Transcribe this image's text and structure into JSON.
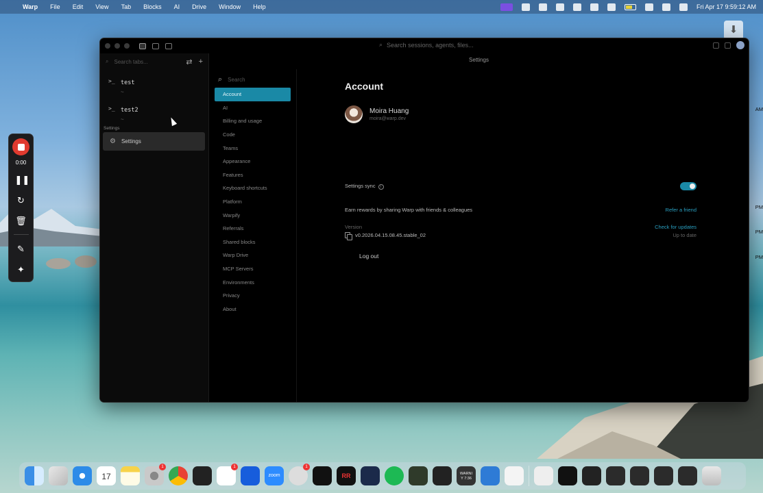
{
  "menubar": {
    "app_name": "Warp",
    "menus": [
      "File",
      "Edit",
      "View",
      "Tab",
      "Blocks",
      "AI",
      "Drive",
      "Window",
      "Help"
    ],
    "clock": "Fri Apr 17  9:59:12 AM",
    "battery": "62"
  },
  "recorder": {
    "timer": "0:00"
  },
  "window": {
    "global_search_placeholder": "Search sessions, agents, files...",
    "header_title": "Settings"
  },
  "tabs_panel": {
    "search_placeholder": "Search tabs...",
    "sessions": [
      {
        "title": "test",
        "subtitle": "~"
      },
      {
        "title": "test2",
        "subtitle": "~"
      }
    ],
    "section_label": "Settings",
    "settings_tab_label": "Settings"
  },
  "settings_nav": {
    "search_placeholder": "Search",
    "items": [
      "Account",
      "AI",
      "Billing and usage",
      "Code",
      "Teams",
      "Appearance",
      "Features",
      "Keyboard shortcuts",
      "Platform",
      "Warpify",
      "Referrals",
      "Shared blocks",
      "Warp Drive",
      "MCP Servers",
      "Environments",
      "Privacy",
      "About"
    ],
    "active": "Account"
  },
  "account": {
    "heading": "Account",
    "user_name": "Moira Huang",
    "user_email": "moira@warp.dev",
    "settings_sync_label": "Settings sync",
    "settings_sync_on": true,
    "referral_text": "Earn rewards by sharing Warp with friends & colleagues",
    "referral_link": "Refer a friend",
    "version_label": "Version",
    "version_value": "v0.2026.04.15.08.45.stable_02",
    "check_updates_label": "Check for updates",
    "update_status": "Up to date",
    "logout_label": "Log out"
  },
  "desktop_peek": [
    "AM",
    "PM",
    "PM",
    "PM"
  ],
  "colors": {
    "accent": "#1a89a6",
    "link": "#2a9fc0",
    "record": "#e03a2f"
  },
  "dock": {
    "icons": [
      "finder-icon",
      "launchpad-icon",
      "safari-icon",
      "calendar-icon",
      "notes-icon",
      "system-settings-icon",
      "chrome-icon",
      "warp-icon",
      "slack-icon",
      "bitwarden-icon",
      "zoom-icon",
      "linear-icon",
      "warp-preview-icon",
      "rr-icon",
      "terminal-icon",
      "spotify-icon",
      "spiral-icon",
      "warp-dev-icon",
      "console-icon",
      "sparkle-icon",
      "warp-alt-icon"
    ],
    "calendar_date": "17",
    "zoom_label": "zoom",
    "rr_label": "RR",
    "console_label_1": "WARNI",
    "console_label_2": "Y 7:36",
    "badges": {
      "system_settings": "1",
      "slack": "1",
      "linear": "1"
    }
  }
}
